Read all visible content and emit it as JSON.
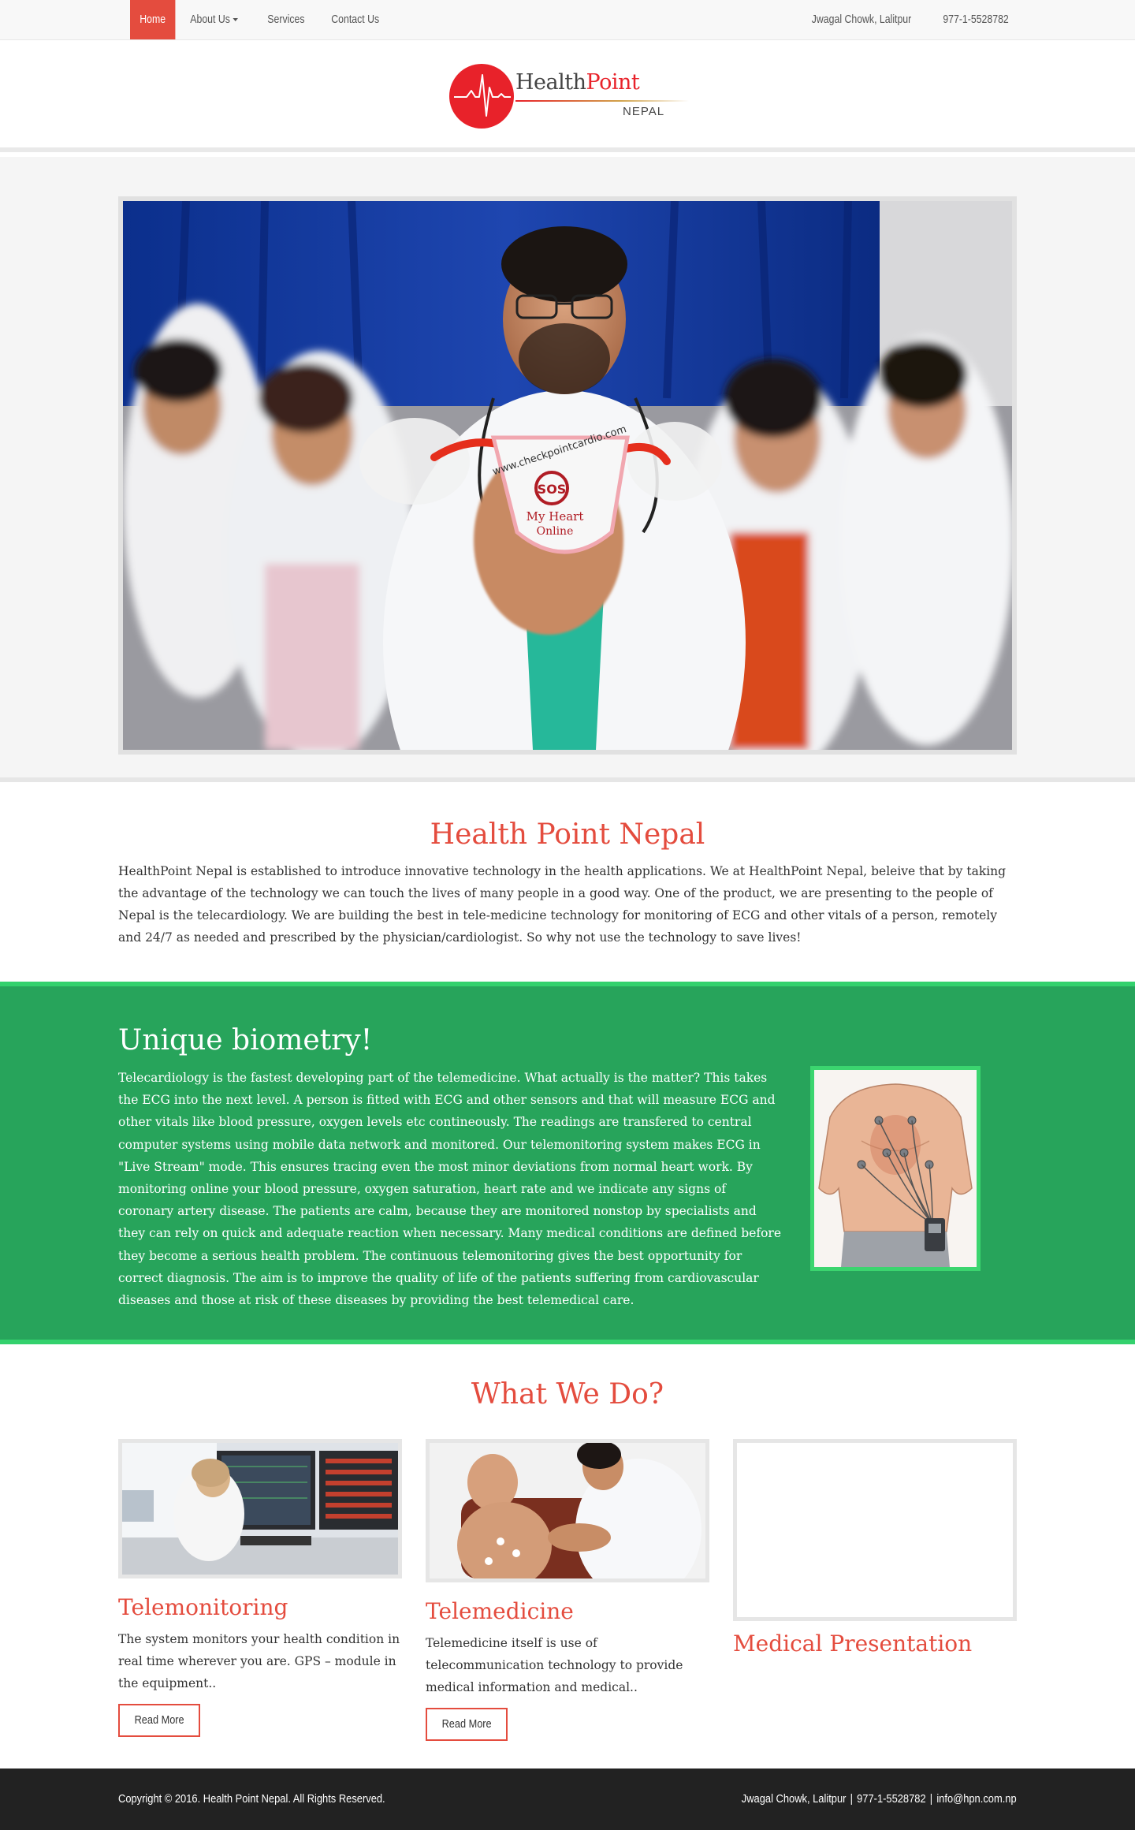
{
  "nav": {
    "items": [
      {
        "label": "Home",
        "active": true
      },
      {
        "label": "About Us",
        "dropdown": true
      },
      {
        "label": "Services"
      },
      {
        "label": "Contact Us"
      }
    ],
    "location": "Jwagal Chowk, Lalitpur",
    "phone": "977-1-5528782"
  },
  "logo": {
    "word1": "Health",
    "word2": "Point",
    "sub": "NEPAL"
  },
  "hero": {
    "device_url": "www.checkpointcardio.com",
    "device_sos": "SOS",
    "device_line1": "My Heart",
    "device_line2": "Online"
  },
  "about": {
    "title": "Health Point Nepal",
    "text": "HealthPoint Nepal is established to introduce innovative technology in the health applications. We at HealthPoint Nepal, beleive that by taking the advantage of the technology we can touch the lives of many people in a good way. One of the product, we are presenting to the people of Nepal is the telecardiology. We are building the best in tele-medicine technology for monitoring of ECG and other vitals of a person, remotely and 24/7 as needed and prescribed by the physician/cardiologist. So why not use the technology to save lives!"
  },
  "biometry": {
    "title": "Unique biometry!",
    "text": "Telecardiology is the fastest developing part of the telemedicine. What actually is the matter? This takes the ECG into the next level. A person is fitted with ECG and other sensors and that will measure ECG and other vitals like blood pressure, oxygen levels etc contineously. The readings are transfered to central computer systems using mobile data network and monitored. Our telemonitoring system makes ECG in \"Live Stream\" mode. This ensures tracing even the most minor deviations from normal heart work. By monitoring online your blood pressure, oxygen saturation, heart rate and we indicate any signs of coronary artery disease. The patients are calm, because they are monitored nonstop by specialists and they can rely on quick and adequate reaction when necessary. Many medical conditions are defined before they become a serious health problem. The continuous telemonitoring gives the best opportunity for correct diagnosis. The aim is to improve the quality of life of the patients suffering from cardiovascular diseases and those at risk of these diseases by providing the best telemedical care."
  },
  "services": {
    "title": "What We Do?",
    "cards": [
      {
        "title": "Telemonitoring",
        "text": "The system monitors your health condition in real time wherever you are. GPS – module in the equipment..",
        "button": "Read More"
      },
      {
        "title": "Telemedicine",
        "text": "Telemedicine itself is use of telecommunication technology to provide medical information and medical..",
        "button": "Read More"
      },
      {
        "title": "Medical Presentation"
      }
    ]
  },
  "footer": {
    "copyright": "Copyright © 2016. Health Point Nepal. All Rights Reserved.",
    "location": "Jwagal Chowk, Lalitpur",
    "phone": "977-1-5528782",
    "email": "info@hpn.com.np",
    "separator": "|"
  },
  "colors": {
    "accent": "#e44c3e",
    "green": "#27a45b",
    "green_border": "#33d16d",
    "footer_bg": "#222222"
  }
}
